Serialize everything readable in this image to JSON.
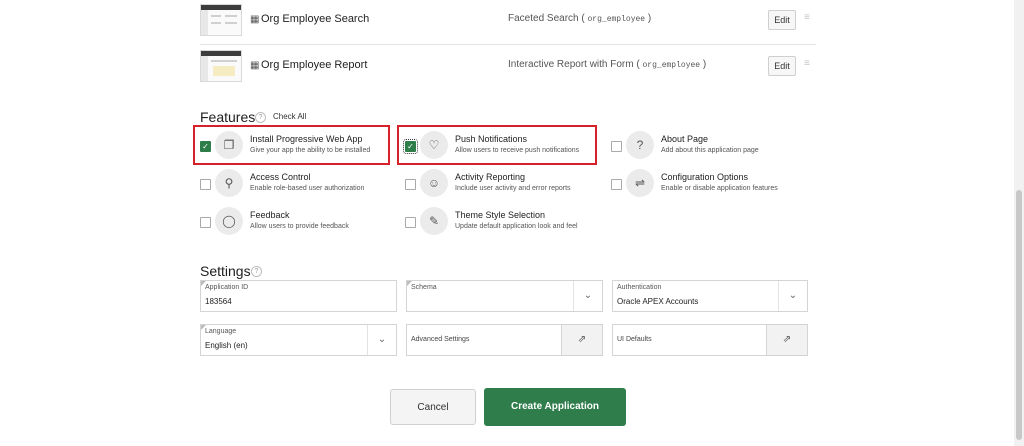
{
  "pages": [
    {
      "name": "Org Employee Search",
      "type_prefix": "Faceted Search ( ",
      "table": "org_employee",
      "type_suffix": " )",
      "edit_label": "Edit"
    },
    {
      "name": "Org Employee Report",
      "type_prefix": "Interactive Report with Form ( ",
      "table": "org_employee",
      "type_suffix": " )",
      "edit_label": "Edit"
    }
  ],
  "features": {
    "title": "Features",
    "check_all": "Check All",
    "items": [
      {
        "title": "Install Progressive Web App",
        "description": "Give your app the ability to be installed",
        "checked": true,
        "icon": "cube-icon"
      },
      {
        "title": "Push Notifications",
        "description": "Allow users to receive push notifications",
        "checked": true,
        "icon": "bell-icon"
      },
      {
        "title": "About Page",
        "description": "Add about this application page",
        "checked": false,
        "icon": "question-icon"
      },
      {
        "title": "Access Control",
        "description": "Enable role-based user authorization",
        "checked": false,
        "icon": "key-icon"
      },
      {
        "title": "Activity Reporting",
        "description": "Include user activity and error reports",
        "checked": false,
        "icon": "user-lock-icon"
      },
      {
        "title": "Configuration Options",
        "description": "Enable or disable application features",
        "checked": false,
        "icon": "sliders-icon"
      },
      {
        "title": "Feedback",
        "description": "Allow users to provide feedback",
        "checked": false,
        "icon": "comment-icon"
      },
      {
        "title": "Theme Style Selection",
        "description": "Update default application look and feel",
        "checked": false,
        "icon": "brush-icon"
      }
    ]
  },
  "settings": {
    "title": "Settings",
    "application_id": {
      "label": "Application ID",
      "value": "183564"
    },
    "schema": {
      "label": "Schema",
      "value": ""
    },
    "authentication": {
      "label": "Authentication",
      "value": "Oracle APEX Accounts"
    },
    "language": {
      "label": "Language",
      "value": "English (en)"
    },
    "advanced_settings": {
      "label": "Advanced Settings"
    },
    "ui_defaults": {
      "label": "UI Defaults"
    }
  },
  "footer": {
    "cancel_label": "Cancel",
    "create_label": "Create Application"
  },
  "colors": {
    "accent_green": "#2f7d4b",
    "highlight_red": "#d6202a"
  }
}
